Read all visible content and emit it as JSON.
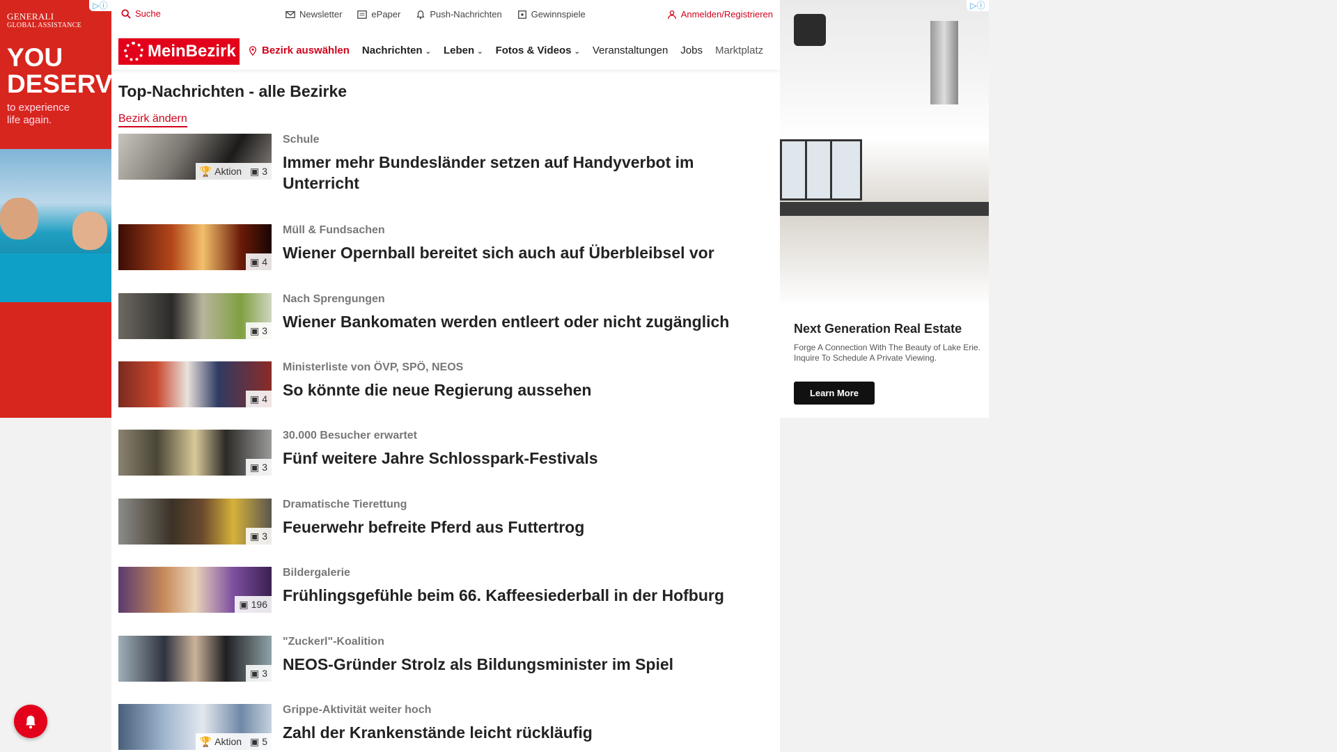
{
  "ad_left": {
    "brand_line1": "GENERALI",
    "brand_line2": "GLOBAL ASSISTANCE",
    "headline_1": "YOU",
    "headline_2": "DESERVE",
    "sub_1": "to experience",
    "sub_2": "life again."
  },
  "topbar": {
    "search": "Suche",
    "newsletter": "Newsletter",
    "epaper": "ePaper",
    "push": "Push-Nachrichten",
    "games": "Gewinnspiele",
    "login": "Anmelden/Registrieren"
  },
  "nav": {
    "logo": "MeinBezirk",
    "bezirk": "Bezirk auswählen",
    "items": [
      "Nachrichten",
      "Leben",
      "Fotos & Videos",
      "Veranstaltungen",
      "Jobs",
      "Marktplatz"
    ]
  },
  "page": {
    "heading": "Top-Nachrichten - alle Bezirke",
    "change_link": "Bezirk ändern"
  },
  "articles": [
    {
      "category": "Schule",
      "title": "Immer mehr Bundesländer setzen auf Handyverbot im Unterricht",
      "action": "Aktion",
      "images": "3"
    },
    {
      "category": "Müll & Fundsachen",
      "title": "Wiener Opernball bereitet sich auch auf Überbleibsel vor",
      "images": "4"
    },
    {
      "category": "Nach Sprengungen",
      "title": "Wiener Bankomaten werden entleert oder nicht zugänglich",
      "images": "3"
    },
    {
      "category": "Ministerliste von ÖVP, SPÖ, NEOS",
      "title": "So könnte die neue Regierung aussehen",
      "images": "4"
    },
    {
      "category": "30.000 Besucher erwartet",
      "title": "Fünf weitere Jahre Schlosspark-Festivals",
      "images": "3"
    },
    {
      "category": "Dramatische Tierettung",
      "title": "Feuerwehr befreite Pferd aus Futtertrog",
      "images": "3"
    },
    {
      "category": "Bildergalerie",
      "title": "Frühlingsgefühle beim 66. Kaffeesiederball in der Hofburg",
      "images": "196"
    },
    {
      "category": "\"Zuckerl\"-Koalition",
      "title": "NEOS-Gründer Strolz als Bildungsminister im Spiel",
      "images": "3"
    },
    {
      "category": "Grippe-Aktivität weiter hoch",
      "title": "Zahl der Krankenstände leicht rückläufig",
      "action": "Aktion",
      "images": "5"
    }
  ],
  "ad_right": {
    "headline": "Next Generation Real Estate",
    "text": "Forge A Connection With The Beauty of Lake Erie. Inquire To Schedule A Private Viewing.",
    "cta": "Learn More"
  },
  "colors": {
    "brand": "#e2001a",
    "link": "#d0021b"
  }
}
